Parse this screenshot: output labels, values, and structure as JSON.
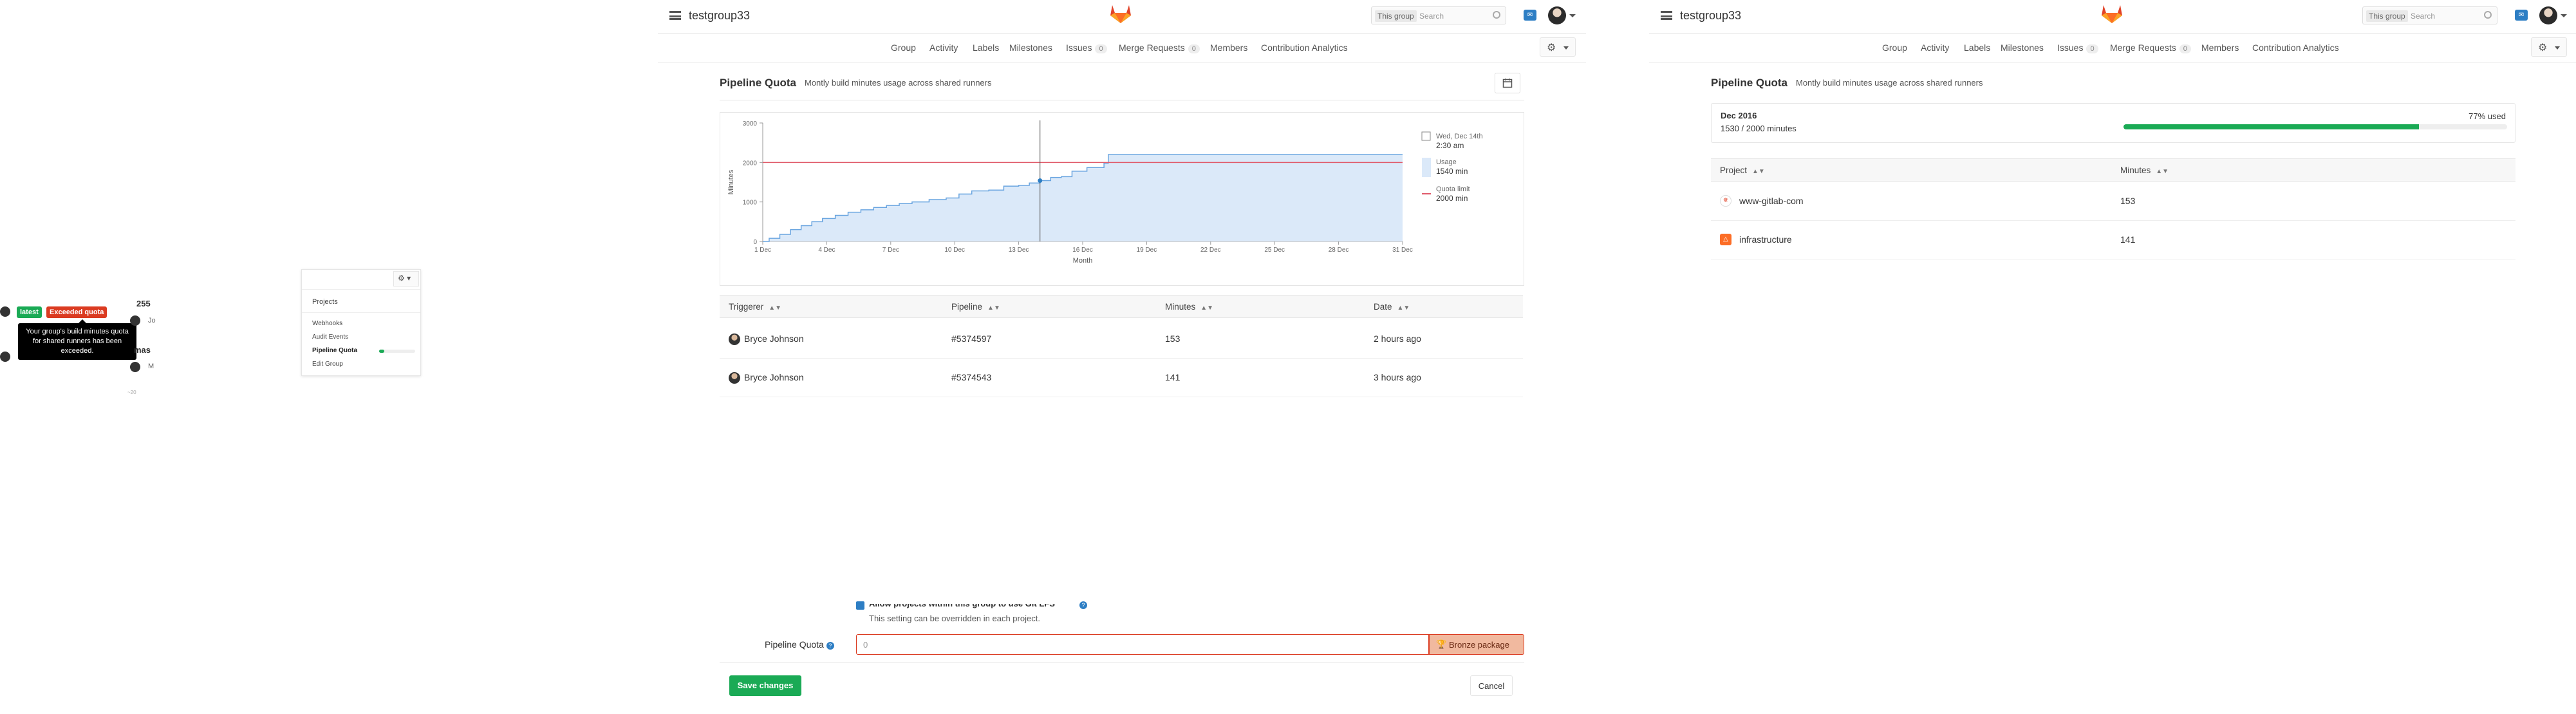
{
  "left_fragment": {
    "badge_latest": "latest",
    "badge_exceeded": "Exceeded quota",
    "tooltip": "Your group's build minutes quota for shared runners has been exceeded.",
    "partial_number": "255",
    "partial_text_1": "Jo",
    "partial_text_2": "mas",
    "partial_text_3": "M",
    "partial_text_4": "~20"
  },
  "mini_dropdown": {
    "items": [
      "Projects",
      "Webhooks",
      "Audit Events",
      "Pipeline Quota",
      "Edit Group"
    ],
    "active": "Pipeline Quota"
  },
  "group_name": "testgroup33",
  "search": {
    "scope": "This group",
    "placeholder": "Search"
  },
  "notifications_count": "",
  "nav": {
    "group": "Group",
    "activity": "Activity",
    "labels": "Labels",
    "milestones": "Milestones",
    "issues": "Issues",
    "issues_count": "0",
    "merge_requests": "Merge Requests",
    "mr_count": "0",
    "members": "Members",
    "contribution": "Contribution Analytics"
  },
  "quota_title": "Pipeline Quota",
  "quota_subtitle": "Montly build minutes usage across shared runners",
  "chart_data": {
    "type": "line",
    "xlabel": "Month",
    "ylabel": "Minutes",
    "ylim": [
      0,
      3000
    ],
    "yticks": [
      "0",
      "1000",
      "2000",
      "3000"
    ],
    "xticks": [
      "1 Dec",
      "4 Dec",
      "7 Dec",
      "10 Dec",
      "13 Dec",
      "16 Dec",
      "19 Dec",
      "22 Dec",
      "25 Dec",
      "28 Dec",
      "31 Dec"
    ],
    "x": [
      1,
      1.3,
      1.8,
      2.3,
      2.8,
      3.3,
      3.8,
      4.4,
      5,
      5.6,
      6.2,
      6.8,
      7.4,
      8,
      8.8,
      9.6,
      10.2,
      10.8,
      11.6,
      12.3,
      13,
      13.5,
      14,
      14.5,
      15,
      15.5,
      16.2,
      17,
      17.2,
      20,
      23,
      26,
      29,
      31
    ],
    "series": [
      {
        "name": "Usage",
        "values": [
          0,
          80,
          180,
          300,
          400,
          500,
          580,
          660,
          740,
          800,
          860,
          910,
          960,
          1000,
          1060,
          1100,
          1200,
          1280,
          1300,
          1400,
          1420,
          1480,
          1540,
          1620,
          1640,
          1780,
          1870,
          1980,
          2200,
          2200,
          2200,
          2200,
          2200,
          2200
        ]
      },
      {
        "name": "Quota limit",
        "values": [
          2000,
          2000
        ]
      }
    ],
    "tooltip": {
      "date": "Wed, Dec 14th",
      "time": "2:30 am",
      "usage_label": "Usage",
      "usage_value": "1540 min",
      "quota_label": "Quota limit",
      "quota_value": "2000 min"
    },
    "colors": {
      "usage": "#6aa5e0",
      "usage_fill": "#dbe9f9",
      "quota": "#e05a6a"
    }
  },
  "pipelines_table": {
    "headers": [
      "Triggerer",
      "Pipeline",
      "Minutes",
      "Date"
    ],
    "rows": [
      {
        "triggerer": "Bryce Johnson",
        "pipeline": "#5374597",
        "minutes": "153",
        "date": "2 hours ago"
      },
      {
        "triggerer": "Bryce Johnson",
        "pipeline": "#5374543",
        "minutes": "141",
        "date": "3 hours ago"
      }
    ]
  },
  "settings": {
    "lfs_label": "Allow projects within this group to use Git LFS",
    "lfs_help": "This setting can be overridden in each project.",
    "quota_label": "Pipeline Quota",
    "quota_value": "0",
    "bronze": "Bronze package",
    "save": "Save changes",
    "cancel": "Cancel"
  },
  "right_panel": {
    "month": "Dec 2016",
    "used_text": "1530 / 2000 minutes",
    "percent_label": "77% used",
    "percent": 77,
    "headers": [
      "Project",
      "Minutes"
    ],
    "rows": [
      {
        "project": "www-gitlab-com",
        "minutes": "153"
      },
      {
        "project": "infrastructure",
        "minutes": "141"
      }
    ]
  },
  "colors": {
    "accent": "#1aaa55",
    "danger": "#db3b21",
    "warning": "#fc6d26",
    "link": "#2e2e2e"
  }
}
